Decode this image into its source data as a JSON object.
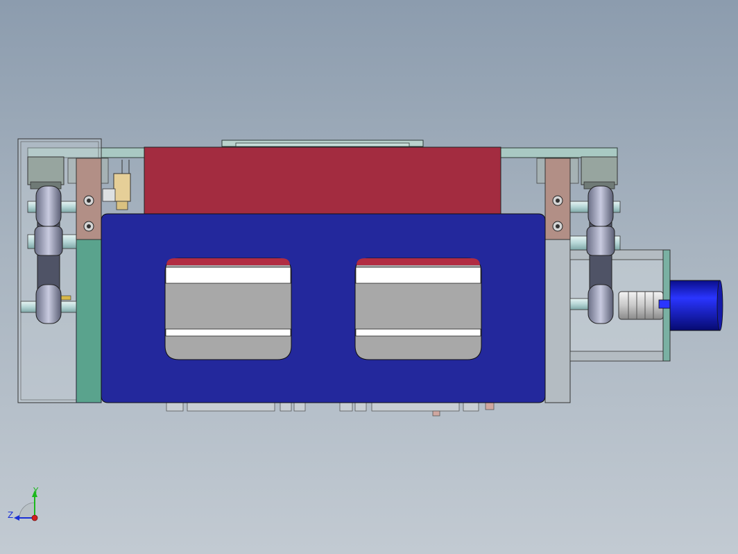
{
  "view": {
    "background_top": "#8c9cae",
    "background_bottom": "#c2cad2"
  },
  "model": {
    "colors": {
      "top_plate": "#a32c40",
      "front_cover": "#23289c",
      "side_block": "#5aa38d",
      "frame": "#cbd3d8",
      "bracket": "#b28f86",
      "motor": "#1218c8",
      "sensor": "#e6cf98",
      "shaft": "#bcdcdc",
      "window_grey": "#a8a8a8"
    },
    "icons": [
      "hex-socket-screw-icon",
      "timing-pulley-icon",
      "coupling-icon",
      "motor-icon",
      "sensor-icon"
    ]
  },
  "triad": {
    "y_label": "Y",
    "z_label": "Z",
    "y_color": "#1cb81c",
    "z_color": "#1a2fd6",
    "x_color": "#d21f1f"
  }
}
